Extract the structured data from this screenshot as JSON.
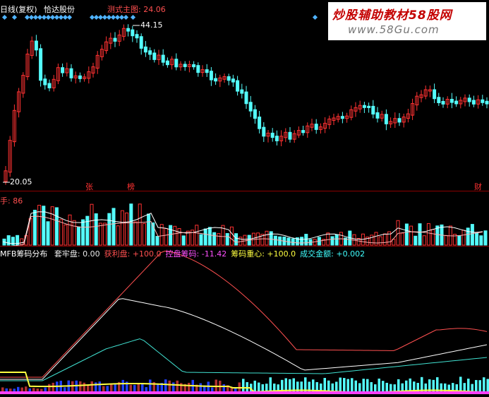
{
  "header": {
    "period": "日线(复权)",
    "stock_name": "恰达股份",
    "indicator": "测式主图: 24.06"
  },
  "price_panel": {
    "high_label": "44.15",
    "low_label": "20.05",
    "marks": [
      "张",
      "榜",
      "财"
    ]
  },
  "volume_panel": {
    "label": "手: 86"
  },
  "indicator_panel": {
    "name": "MFB筹码分布",
    "items": [
      {
        "label": "套牢盘:",
        "value": "0.00",
        "color": "#e8e8e8"
      },
      {
        "label": "获利盘:",
        "value": "+100.0",
        "color": "#ff5050"
      },
      {
        "label": "控盘筹码:",
        "value": "-11.42",
        "color": "#ff50ff"
      },
      {
        "label": "筹码重心:",
        "value": "+100.0",
        "color": "#ffff40"
      },
      {
        "label": "成交金额:",
        "value": "+0.002",
        "color": "#40ffff"
      }
    ]
  },
  "watermark": {
    "title": "炒股辅助教材58股网",
    "url": "www.58Gu.com"
  },
  "colors": {
    "up": "#ff3232",
    "down": "#54fcfc",
    "red_line": "#ff5050",
    "white_line": "#ffffff",
    "cyan_line": "#40e0d0",
    "yellow_line": "#ffff40",
    "panel_border": "#8b0000"
  }
}
